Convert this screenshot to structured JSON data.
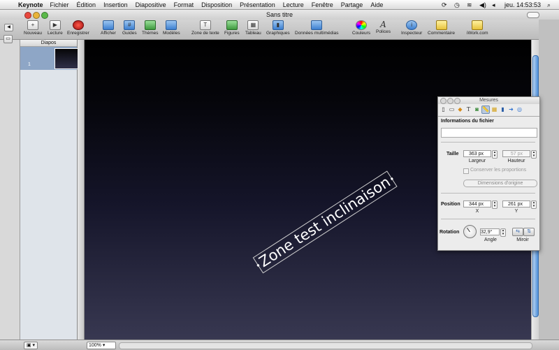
{
  "menubar": {
    "app_name": "Keynote",
    "items": [
      "Fichier",
      "Édition",
      "Insertion",
      "Diapositive",
      "Format",
      "Disposition",
      "Présentation",
      "Lecture",
      "Fenêtre",
      "Partage",
      "Aide"
    ],
    "clock": "jeu. 14:53:53"
  },
  "window": {
    "title": "Sans titre"
  },
  "toolbar": {
    "nouveau": "Nouveau",
    "lecture": "Lecture",
    "enregistrer": "Enregistrer",
    "afficher": "Afficher",
    "guides": "Guides",
    "themes": "Thèmes",
    "modeles": "Modèles",
    "zone_texte": "Zone de texte",
    "figures": "Figures",
    "tableau": "Tableau",
    "graphiques": "Graphiques",
    "donnees": "Données multimédias",
    "couleurs": "Couleurs",
    "polices": "Polices",
    "inspecteur": "Inspecteur",
    "commentaire": "Commentaire",
    "iwork": "iWork.com"
  },
  "diapos": {
    "header": "Diapos",
    "slide_number": "1"
  },
  "slide": {
    "text": "Zone test inclinaison"
  },
  "inspector": {
    "title": "Mesures",
    "file_info_heading": "Informations du fichier",
    "file_info_value": "",
    "size_label": "Taille",
    "width_value": "363 px",
    "width_label": "Largeur",
    "height_value": "57 px",
    "height_label": "Hauteur",
    "keep_proportions": "Conserver les proportions",
    "original_size": "Dimensions d'origine",
    "position_label": "Position",
    "x_value": "344 px",
    "x_label": "X",
    "y_value": "261 px",
    "y_label": "Y",
    "rotation_label": "Rotation",
    "angle_value": "32,9°",
    "angle_label": "Angle",
    "mirror_label": "Miroir"
  },
  "statusbar": {
    "zoom": "100%"
  }
}
